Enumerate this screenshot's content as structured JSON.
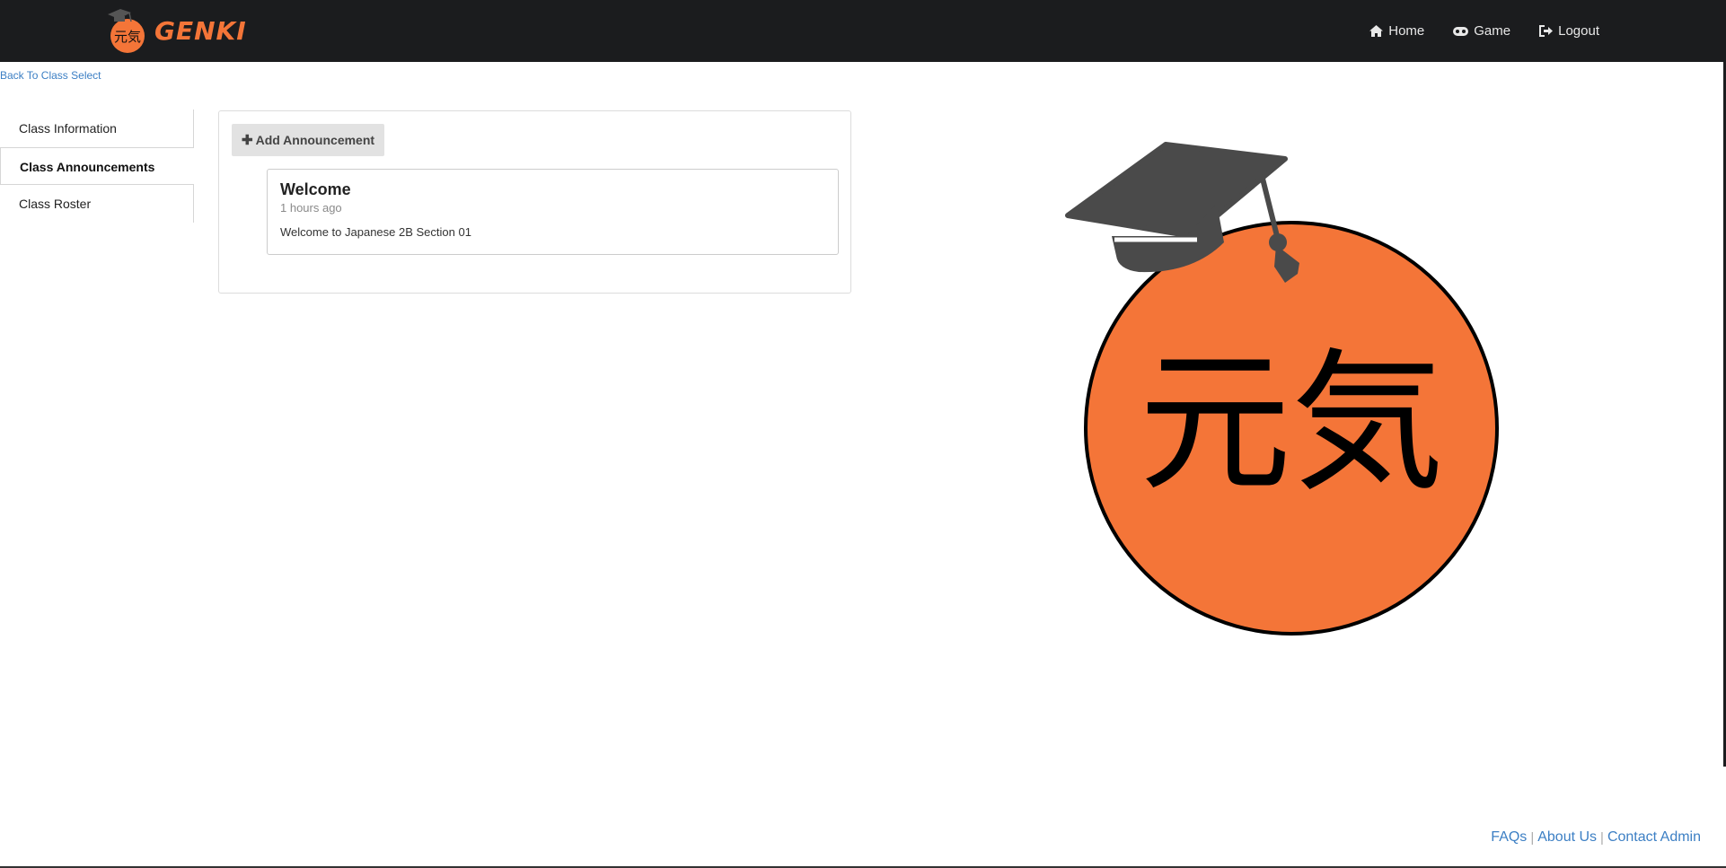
{
  "app": {
    "brand_name": "GENKI"
  },
  "nav": {
    "home": "Home",
    "game": "Game",
    "logout": "Logout"
  },
  "back_link": "Back To Class Select",
  "sidebar": {
    "items": [
      {
        "label": "Class Information"
      },
      {
        "label": "Class Announcements"
      },
      {
        "label": "Class Roster"
      }
    ]
  },
  "main": {
    "add_button": "Add Announcement",
    "announcement": {
      "title": "Welcome",
      "time": "1 hours ago",
      "body": "Welcome to Japanese 2B Section 01"
    }
  },
  "logo": {
    "kanji": "元気"
  },
  "footer": {
    "faqs": "FAQs",
    "about": "About Us",
    "contact": "Contact Admin"
  },
  "colors": {
    "brand_orange": "#f47538",
    "navbar": "#1b1c1e",
    "link_blue": "#3c7fc4"
  }
}
